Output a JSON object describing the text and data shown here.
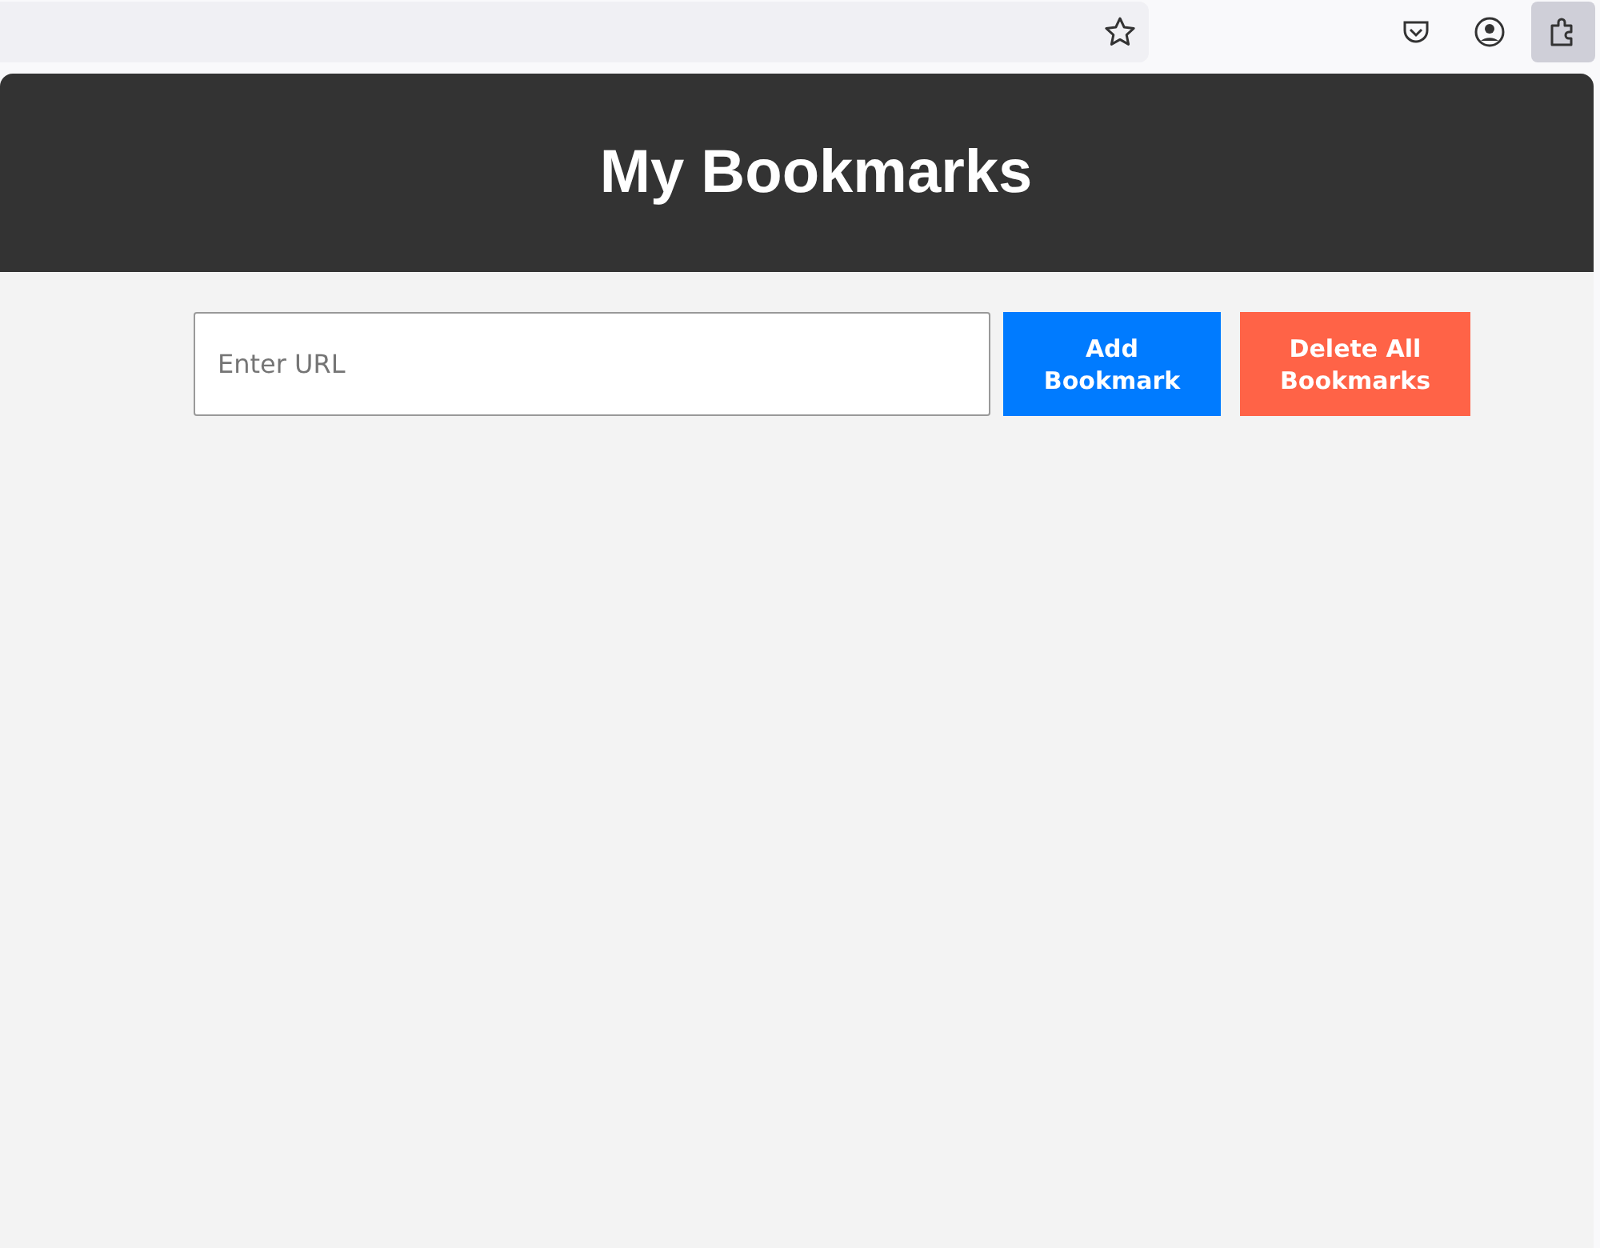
{
  "header": {
    "title": "My Bookmarks"
  },
  "form": {
    "url_field": {
      "placeholder": "Enter URL"
    },
    "buttons": [
      {
        "label": "Add Bookmark",
        "kind": "primary"
      },
      {
        "label": "Delete All Bookmarks",
        "kind": "danger"
      }
    ]
  }
}
